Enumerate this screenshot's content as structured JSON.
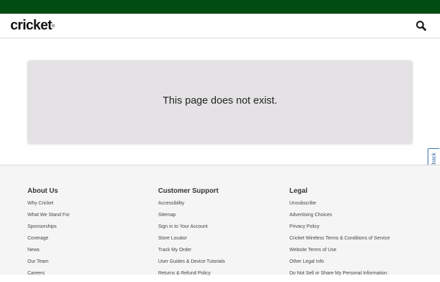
{
  "brand": {
    "logo_text": "cricket",
    "logo_mark": "®"
  },
  "header": {
    "search_icon": "search-icon"
  },
  "error": {
    "message": "This page does not exist."
  },
  "feedback": {
    "label": "Feedback"
  },
  "footer": {
    "about": {
      "heading": "About Us",
      "links": [
        "Why Cricket",
        "What We Stand For",
        "Sponsorships",
        "Coverage",
        "News",
        "Our Team",
        "Careers"
      ]
    },
    "support": {
      "heading": "Customer Support",
      "links": [
        "Accessibility",
        "Sitemap",
        "Sign in to Your Account",
        "Store Locator",
        "Track My Order",
        "User Guides & Device Tutorials",
        "Returns & Refund Policy"
      ]
    },
    "legal": {
      "heading": "Legal",
      "links": [
        "Unsubscribe",
        "Advertising Choices",
        "Privacy Policy",
        "Cricket Wireless Terms & Conditions of Service",
        "Website Terms of Use",
        "Other Legal Info",
        "Do Not Sell or Share My Personal Information"
      ]
    }
  },
  "colors": {
    "brand_green": "#004c11",
    "error_bg": "#e4e2e4",
    "footer_bg": "#f5f5f5",
    "feedback_blue": "#3a6fa8"
  }
}
